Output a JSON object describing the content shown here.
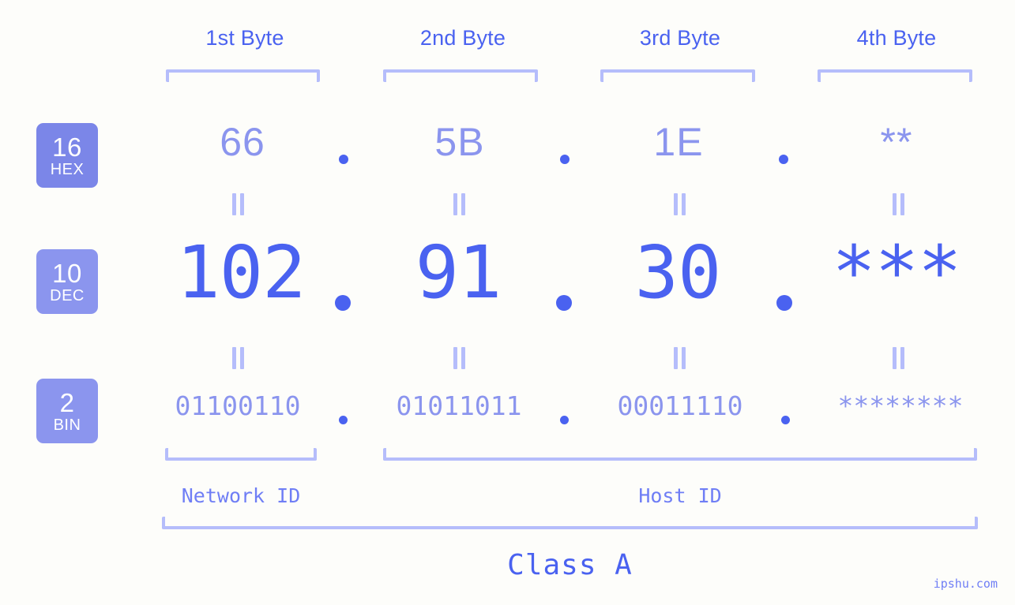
{
  "page": {
    "background_color": "#fdfdfa",
    "accent_color": "#4a62f0",
    "accent_light_color": "#8b95ee",
    "bracket_color": "#b5bdfb",
    "watermark": "ipshu.com"
  },
  "headers": [
    {
      "label": "1st Byte"
    },
    {
      "label": "2nd Byte"
    },
    {
      "label": "3rd Byte"
    },
    {
      "label": "4th Byte"
    }
  ],
  "bases": [
    {
      "number": "16",
      "name": "HEX",
      "color": "#7b86e8"
    },
    {
      "number": "10",
      "name": "DEC",
      "color": "#8b95ee"
    },
    {
      "number": "2",
      "name": "BIN",
      "color": "#8b95ee"
    }
  ],
  "rows": {
    "hex": {
      "values": [
        "66",
        "5B",
        "1E",
        "**"
      ],
      "separators": [
        ".",
        ".",
        "."
      ]
    },
    "dec": {
      "values": [
        "102",
        "91",
        "30",
        "***"
      ],
      "separators": [
        ".",
        ".",
        "."
      ]
    },
    "bin": {
      "values": [
        "01100110",
        "01011011",
        "00011110",
        "********"
      ],
      "separators": [
        ".",
        ".",
        "."
      ]
    }
  },
  "equality": {
    "glyph": "="
  },
  "regions": [
    {
      "label": "Network ID"
    },
    {
      "label": "Host ID"
    }
  ],
  "class": {
    "label": "Class A"
  }
}
